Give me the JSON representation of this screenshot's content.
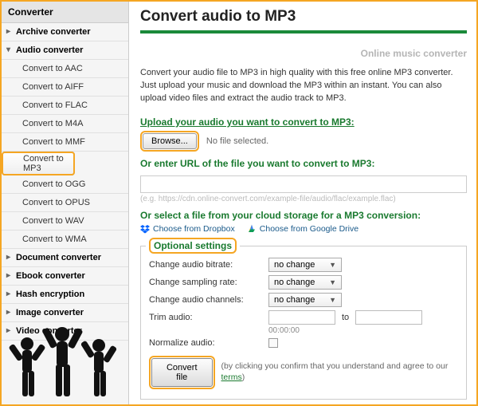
{
  "sidebar": {
    "header": "Converter",
    "items": [
      {
        "label": "Archive converter"
      },
      {
        "label": "Audio converter"
      },
      {
        "label": "Document converter"
      },
      {
        "label": "Ebook converter"
      },
      {
        "label": "Hash encryption"
      },
      {
        "label": "Image converter"
      },
      {
        "label": "Video converter"
      }
    ],
    "audio_sub": [
      {
        "label": "Convert to AAC"
      },
      {
        "label": "Convert to AIFF"
      },
      {
        "label": "Convert to FLAC"
      },
      {
        "label": "Convert to M4A"
      },
      {
        "label": "Convert to MMF"
      },
      {
        "label": "Convert to MP3"
      },
      {
        "label": "Convert to OGG"
      },
      {
        "label": "Convert to OPUS"
      },
      {
        "label": "Convert to WAV"
      },
      {
        "label": "Convert to WMA"
      }
    ]
  },
  "main": {
    "title": "Convert audio to MP3",
    "omc": "Online music converter",
    "intro": "Convert your audio file to MP3 in high quality with this free online MP3 converter. Just upload your music and download the MP3 within an instant. You can also upload video files and extract the audio track to MP3.",
    "upload_title": "Upload your audio you want to convert to MP3:",
    "browse_label": "Browse...",
    "no_file": "No file selected.",
    "url_title": "Or enter URL of the file you want to convert to MP3:",
    "url_hint": "(e.g. https://cdn.online-convert.com/example-file/audio/flac/example.flac)",
    "cloud_title": "Or select a file from your cloud storage for a MP3 conversion:",
    "cloud": {
      "dropbox": "Choose from Dropbox",
      "gdrive": "Choose from Google Drive"
    },
    "opt": {
      "legend": "Optional settings",
      "bitrate": "Change audio bitrate:",
      "sampling": "Change sampling rate:",
      "channels": "Change audio channels:",
      "no_change": "no change",
      "trim": "Trim audio:",
      "trim_help": "00:00:00",
      "to": "to",
      "normalize": "Normalize audio:"
    },
    "convert_label": "Convert file",
    "confirm_a": "(by clicking you confirm that you understand and agree to our ",
    "confirm_link": "terms",
    "confirm_b": ")"
  }
}
